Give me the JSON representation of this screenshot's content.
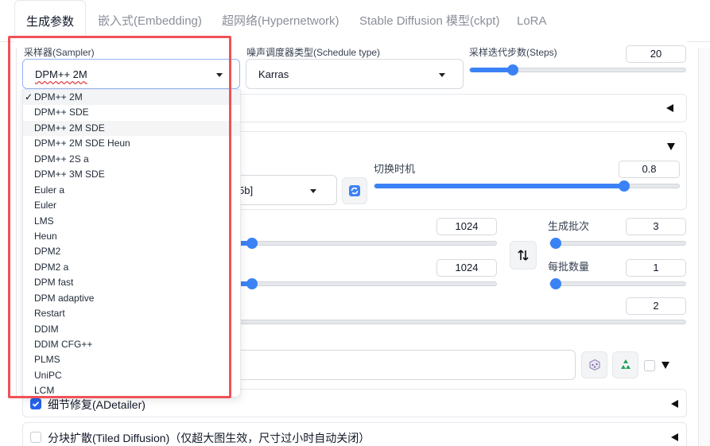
{
  "tabs": [
    {
      "label": "生成参数",
      "active": true
    },
    {
      "label": "嵌入式(Embedding)",
      "active": false
    },
    {
      "label": "超网络(Hypernetwork)",
      "active": false
    },
    {
      "label": "Stable Diffusion 模型(ckpt)",
      "active": false
    },
    {
      "label": "LoRA",
      "active": false
    }
  ],
  "sampler": {
    "label": "采样器(Sampler)",
    "value": "DPM++ 2M",
    "options": [
      "DPM++ 2M",
      "DPM++ SDE",
      "DPM++ 2M SDE",
      "DPM++ 2M SDE Heun",
      "DPM++ 2S a",
      "DPM++ 3M SDE",
      "Euler a",
      "Euler",
      "LMS",
      "Heun",
      "DPM2",
      "DPM2 a",
      "DPM fast",
      "DPM adaptive",
      "Restart",
      "DDIM",
      "DDIM CFG++",
      "PLMS",
      "UniPC",
      "LCM"
    ],
    "selected_index": 0,
    "check_mark": "✓"
  },
  "schedule": {
    "label": "噪声调度器类型(Schedule type)",
    "value": "Karras"
  },
  "steps": {
    "label": "采样迭代步数(Steps)",
    "value": "20",
    "fraction": 0.2
  },
  "refiner": {
    "switch_label": "切换时机",
    "switch_value": "0.8",
    "switch_fraction": 0.82,
    "model_partial": "5b]"
  },
  "width": {
    "value": "1024",
    "fraction": 0.5
  },
  "height": {
    "value": "1024",
    "fraction": 0.5
  },
  "batch_count": {
    "label": "生成批次",
    "value": "3",
    "fraction": 0.0
  },
  "batch_size": {
    "label": "每批数量",
    "value": "1",
    "fraction": 0.0
  },
  "cfg": {
    "value": "2"
  },
  "adetailer": {
    "label": "细节修复(ADetailer)",
    "checked": true
  },
  "tiled": {
    "label": "分块扩散(Tiled Diffusion)（仅超大图生效，尺寸过小时自动关闭）",
    "checked": false
  },
  "icons": {
    "swap": "swap-arrows-icon",
    "refresh": "refresh-icon",
    "dice": "dice-icon",
    "recycle": "recycle-icon"
  },
  "colors": {
    "accent": "#3b82f6",
    "highlight_box": "#ef5257"
  }
}
